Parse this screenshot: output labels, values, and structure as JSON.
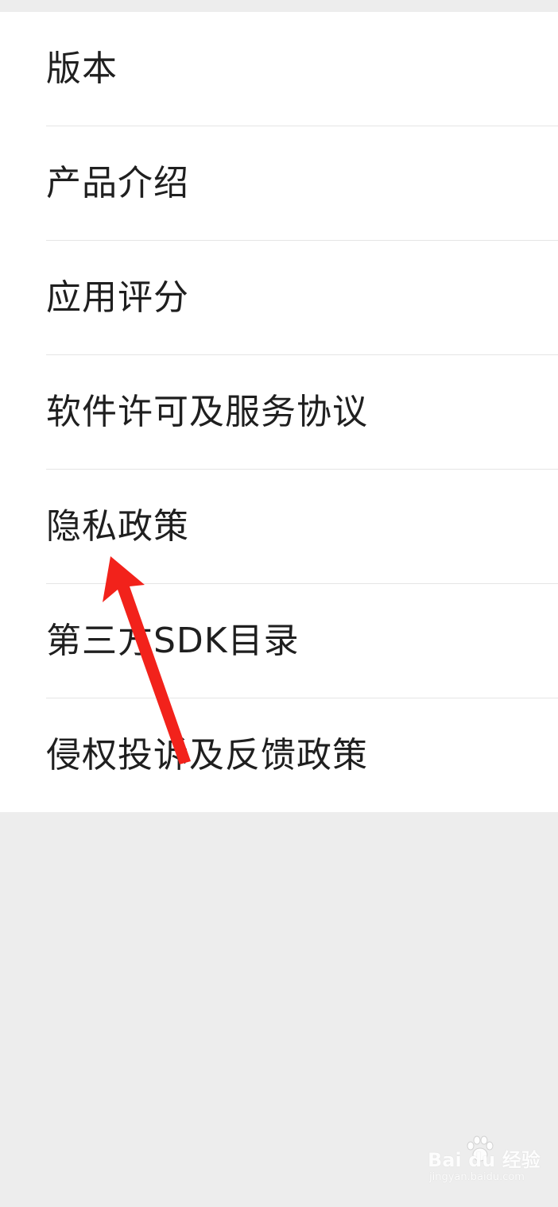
{
  "menu": {
    "items": [
      {
        "label": "版本"
      },
      {
        "label": "产品介绍"
      },
      {
        "label": "应用评分"
      },
      {
        "label": "软件许可及服务协议"
      },
      {
        "label": "隐私政策"
      },
      {
        "label": "第三方SDK目录"
      },
      {
        "label": "侵权投诉及反馈政策"
      }
    ]
  },
  "annotation": {
    "icon": "red-arrow-icon",
    "color": "#f2221b",
    "points_to": "隐私政策"
  },
  "watermark": {
    "main": "Bai du 经验",
    "sub": "jingyan.baidu.com"
  },
  "colors": {
    "background": "#ededed",
    "list_background": "#ffffff",
    "text": "#1f1f1f",
    "divider": "#e5e5e5"
  }
}
